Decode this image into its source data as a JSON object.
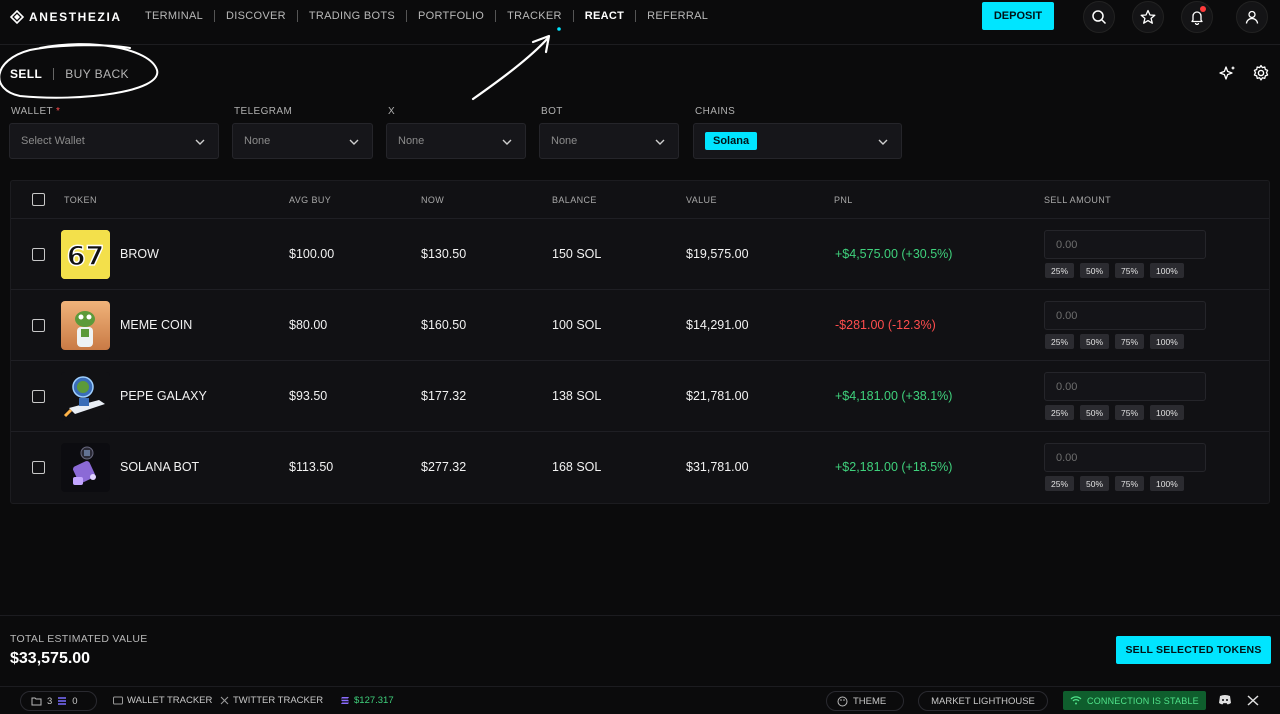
{
  "brand": {
    "name": "ANESTHEZIA"
  },
  "nav": {
    "items": [
      {
        "label": "TERMINAL",
        "active": false
      },
      {
        "label": "DISCOVER",
        "active": false
      },
      {
        "label": "TRADING BOTS",
        "active": false
      },
      {
        "label": "PORTFOLIO",
        "active": false
      },
      {
        "label": "TRACKER",
        "active": false
      },
      {
        "label": "REACT",
        "active": true
      },
      {
        "label": "REFERRAL",
        "active": false
      }
    ]
  },
  "header": {
    "deposit_label": "DEPOSIT",
    "icons": [
      "search-icon",
      "star-icon",
      "bell-icon",
      "user-icon"
    ]
  },
  "mode_tabs": {
    "sell": "SELL",
    "buy_back": "BUY BACK",
    "active": "SELL"
  },
  "filters": {
    "wallet": {
      "label": "WALLET",
      "required_mark": "*",
      "placeholder": "Select Wallet"
    },
    "telegram": {
      "label": "TELEGRAM",
      "value": "None"
    },
    "x": {
      "label": "X",
      "value": "None"
    },
    "bot": {
      "label": "BOT",
      "value": "None"
    },
    "chains": {
      "label": "CHAINS",
      "value": "Solana"
    }
  },
  "table": {
    "columns": [
      "TOKEN",
      "AVG BUY",
      "NOW",
      "BALANCE",
      "VALUE",
      "PNL",
      "SELL AMOUNT"
    ],
    "rows": [
      {
        "token": "BROW",
        "avg_buy": "$100.00",
        "now": "$130.50",
        "balance": "150 SOL",
        "value": "$19,575.00",
        "pnl": "+$4,575.00 (+30.5%)",
        "pnl_positive": true,
        "sell_amount_placeholder": "0.00"
      },
      {
        "token": "MEME COIN",
        "avg_buy": "$80.00",
        "now": "$160.50",
        "balance": "100 SOL",
        "value": "$14,291.00",
        "pnl": "-$281.00 (-12.3%)",
        "pnl_positive": false,
        "sell_amount_placeholder": "0.00"
      },
      {
        "token": "PEPE GALAXY",
        "avg_buy": "$93.50",
        "now": "$177.32",
        "balance": "138 SOL",
        "value": "$21,781.00",
        "pnl": "+$4,181.00 (+38.1%)",
        "pnl_positive": true,
        "sell_amount_placeholder": "0.00"
      },
      {
        "token": "SOLANA BOT",
        "avg_buy": "$113.50",
        "now": "$277.32",
        "balance": "168 SOL",
        "value": "$31,781.00",
        "pnl": "+$2,181.00 (+18.5%)",
        "pnl_positive": true,
        "sell_amount_placeholder": "0.00"
      }
    ],
    "percent_options": [
      "25%",
      "50%",
      "75%",
      "100%"
    ],
    "brow_logo_text": "67"
  },
  "summary": {
    "label": "TOTAL ESTIMATED VALUE",
    "value": "$33,575.00",
    "sell_button": "SELL SELECTED TOKENS"
  },
  "statusbar": {
    "count_a": "3",
    "count_b": "0",
    "wallet_tracker": "WALLET TRACKER",
    "twitter_tracker": "TWITTER TRACKER",
    "sol_price": "$127.317",
    "theme": "THEME",
    "market_lighthouse": "MARKET LIGHTHOUSE",
    "connection": "CONNECTION IS STABLE"
  },
  "colors": {
    "accent": "#00e5ff",
    "positive": "#3fd17c",
    "negative": "#ff4d4d",
    "notification": "#ff3b3b",
    "stable_bg": "#0f5e2d"
  }
}
